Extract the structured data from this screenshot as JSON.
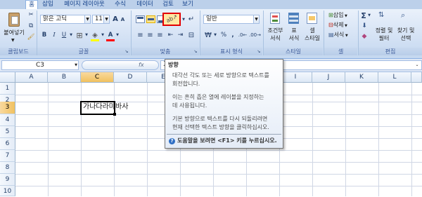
{
  "tabs": [
    "홈",
    "삽입",
    "페이지 레이아웃",
    "수식",
    "데이터",
    "검토",
    "보기"
  ],
  "clipboard": {
    "paste_label": "붙여넣기",
    "group_label": "클립보드"
  },
  "font": {
    "name": "맑은 고딕",
    "size": "11",
    "bold": "B",
    "italic": "I",
    "underline": "U",
    "grow": "A",
    "shrink": "A",
    "color_glyph": "가",
    "color_a": "A",
    "group_label": "글꼴"
  },
  "alignment": {
    "group_label": "맞춤"
  },
  "number": {
    "format": "일반",
    "percent": "%",
    "comma": ",",
    "group_label": "표시 형식"
  },
  "styles": {
    "conditional": "조건부\n서식",
    "table": "표\n서식",
    "cell": "셀\n스타일",
    "group_label": "스타일"
  },
  "cells": {
    "insert": "삽입",
    "delete": "삭제",
    "format": "서식",
    "group_label": "셀"
  },
  "editing": {
    "sum": "Σ",
    "sort": "정렬 및\n필터",
    "find": "찾기 및\n선택",
    "group_label": "편집"
  },
  "namebox": "C3",
  "formula_prefix": "fx",
  "formula_value": "가나다라마",
  "columns": [
    "A",
    "B",
    "C",
    "D",
    "E",
    "F",
    "G",
    "H",
    "I",
    "J",
    "K",
    "L"
  ],
  "rows": [
    "1",
    "2",
    "3",
    "4",
    "5",
    "6",
    "7",
    "8",
    "9",
    "10"
  ],
  "cell_c3": "가나다라마바사",
  "tooltip": {
    "title": "방향",
    "line1": "대각선 각도 또는 세로 방향으로 텍스트를",
    "line2": "회전합니다.",
    "line3": "이는 흔히 좁은 열에 레이블을 지정하는",
    "line4": "데 사용됩니다.",
    "line5": "기본 방향으로 텍스트를 다시 되돌리려면",
    "line6": "현재 선택한 텍스트 방향을 클릭하십시오.",
    "help": "도움말을 보려면 <F1> 키를 누르십시오."
  },
  "colors": {
    "highlight_border": "#e30000",
    "selected_header": "#f1c15f",
    "font_red": "#ff0000",
    "fill_yellow": "#ffff00"
  }
}
